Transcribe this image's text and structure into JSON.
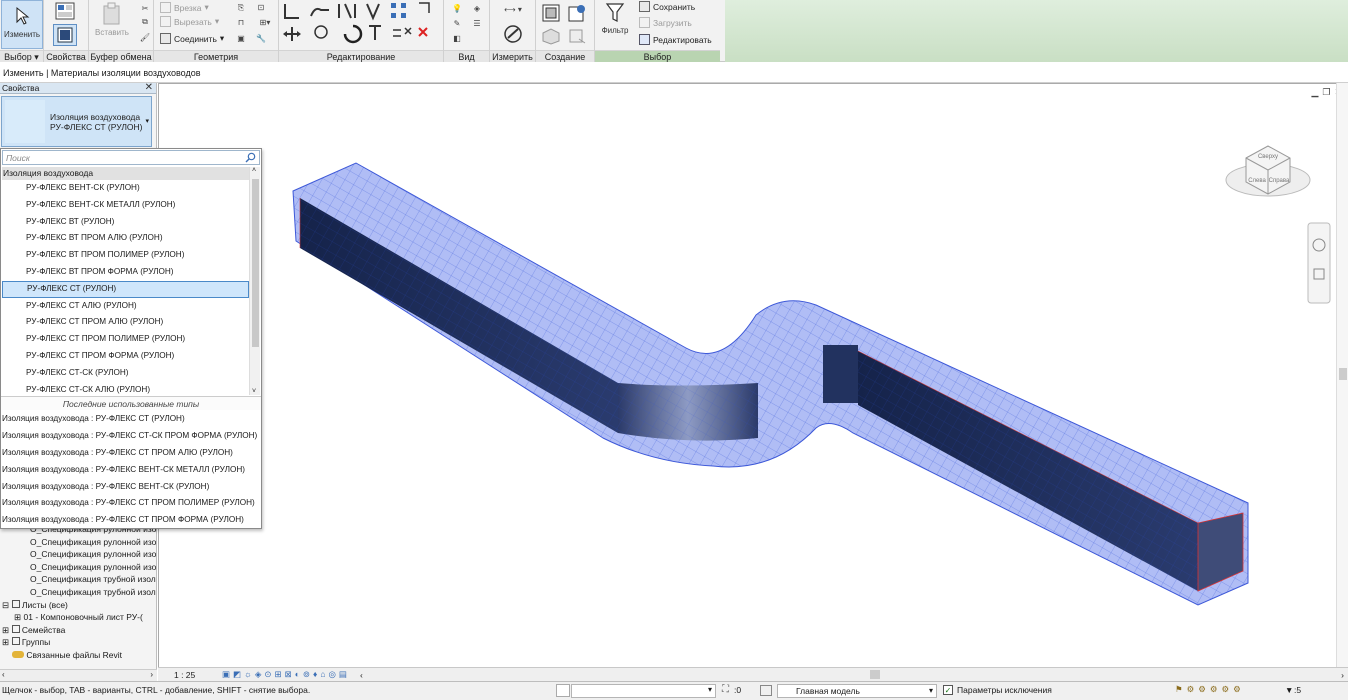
{
  "ribbon": {
    "modify_label": "Изменить",
    "panels": {
      "select": "Выбор",
      "properties": "Свойства",
      "clipboard": "Буфер обмена",
      "geometry": "Геометрия",
      "modify": "Редактирование",
      "view": "Вид",
      "measure": "Измерить",
      "create": "Создание",
      "selection": "Выбор"
    },
    "paste_label": "Вставить",
    "cut_label": "Врезка",
    "unjoin_label": "Вырезать",
    "join_label": "Соединить",
    "filter_label": "Фильтр",
    "save_label": "Сохранить",
    "load_label": "Загрузить",
    "edit_label": "Редактировать"
  },
  "options_bar": {
    "text": "Изменить | Материалы изоляции воздуховодов"
  },
  "properties": {
    "title": "Свойства",
    "close": "✕",
    "type_line1": "Изоляция воздуховода",
    "type_line2": "РУ-ФЛЕКС СТ (РУЛОН)"
  },
  "dropdown": {
    "search_placeholder": "Поиск",
    "group_header": "Изоляция воздуховода",
    "items": [
      "РУ-ФЛЕКС ВЕНТ-СК (РУЛОН)",
      "РУ-ФЛЕКС ВЕНТ-СК МЕТАЛЛ (РУЛОН)",
      "РУ-ФЛЕКС ВТ (РУЛОН)",
      "РУ-ФЛЕКС ВТ ПРОМ АЛЮ (РУЛОН)",
      "РУ-ФЛЕКС ВТ ПРОМ ПОЛИМЕР (РУЛОН)",
      "РУ-ФЛЕКС ВТ ПРОМ ФОРМА (РУЛОН)",
      "РУ-ФЛЕКС СТ (РУЛОН)",
      "РУ-ФЛЕКС СТ АЛЮ (РУЛОН)",
      "РУ-ФЛЕКС СТ ПРОМ АЛЮ (РУЛОН)",
      "РУ-ФЛЕКС СТ ПРОМ ПОЛИМЕР (РУЛОН)",
      "РУ-ФЛЕКС СТ ПРОМ ФОРМА (РУЛОН)",
      "РУ-ФЛЕКС СТ-СК (РУЛОН)",
      "РУ-ФЛЕКС СТ-СК АЛЮ (РУЛОН)"
    ],
    "selected_index": 6,
    "recent_header": "Последние использованные типы",
    "recent": [
      "Изоляция воздуховода : РУ-ФЛЕКС СТ (РУЛОН)",
      "Изоляция воздуховода : РУ-ФЛЕКС СТ-СК ПРОМ ФОРМА (РУЛОН)",
      "Изоляция воздуховода : РУ-ФЛЕКС СТ ПРОМ АЛЮ (РУЛОН)",
      "Изоляция воздуховода : РУ-ФЛЕКС ВЕНТ-СК МЕТАЛЛ (РУЛОН)",
      "Изоляция воздуховода : РУ-ФЛЕКС ВЕНТ-СК (РУЛОН)",
      "Изоляция воздуховода : РУ-ФЛЕКС СТ ПРОМ ПОЛИМЕР (РУЛОН)",
      "Изоляция воздуховода : РУ-ФЛЕКС СТ ПРОМ ФОРМА (РУЛОН)"
    ]
  },
  "browser": {
    "items": [
      {
        "label": "О_Спецификация рулонной изо",
        "prefix": ""
      },
      {
        "label": "О_Спецификация рулонной изо",
        "prefix": ""
      },
      {
        "label": "О_Спецификация рулонной изо",
        "prefix": ""
      },
      {
        "label": "О_Спецификация рулонной изо",
        "prefix": ""
      },
      {
        "label": "О_Спецификация трубной изол",
        "prefix": ""
      },
      {
        "label": "О_Спецификация трубной изол",
        "prefix": ""
      },
      {
        "label": "Листы (все)",
        "prefix": "⊟"
      },
      {
        "label": "01 - Компоновочный лист РУ-(",
        "prefix": "⊞"
      },
      {
        "label": "Семейства",
        "prefix": "⊞"
      },
      {
        "label": "Группы",
        "prefix": "⊞"
      },
      {
        "label": "Связанные файлы Revit",
        "prefix": ""
      }
    ]
  },
  "viewcube": {
    "top": "Сверху",
    "left": "Слева",
    "front": "Справа"
  },
  "viewbar": {
    "scale": "1 : 25"
  },
  "statusbar": {
    "hint": "Щелчок - выбор, TAB - варианты, CTRL - добавление, SHIFT - снятие выбора.",
    "count": ":0",
    "model": "Главная модель",
    "exclusions": "Параметры исключения",
    "filter_count": ":5"
  },
  "colors": {
    "accent": "#3b6fb6",
    "duct_dark": "#1f2d55",
    "insulation": "#5878e6",
    "selection": "#cfe6fb",
    "ribbon_green": "#c9dfc4"
  }
}
